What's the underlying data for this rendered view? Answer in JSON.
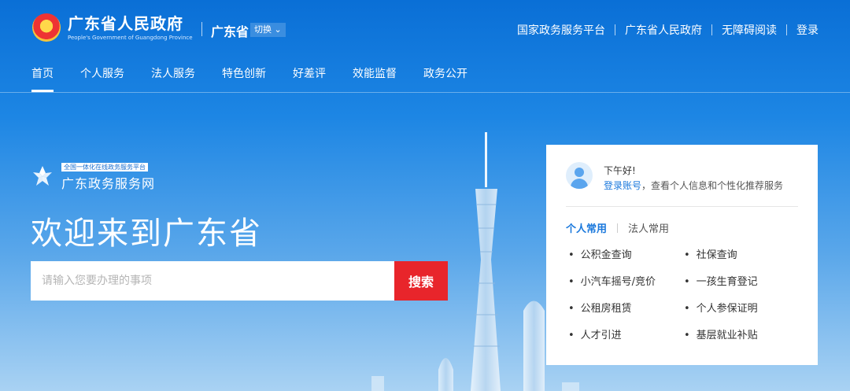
{
  "header": {
    "gov_title": "广东省人民政府",
    "gov_subtitle": "People's Government of Guangdong Province",
    "region": "广东省",
    "switch_label": "切换",
    "links": [
      "国家政务服务平台",
      "广东省人民政府",
      "无障碍阅读",
      "登录"
    ]
  },
  "nav": {
    "items": [
      "首页",
      "个人服务",
      "法人服务",
      "特色创新",
      "好差评",
      "效能监督",
      "政务公开"
    ],
    "active": "首页"
  },
  "hero": {
    "badge": "全国一体化在线政务服务平台",
    "brand_name": "广东政务服务网",
    "title": "欢迎来到广东省",
    "search_placeholder": "请输入您要办理的事项",
    "search_button": "搜索"
  },
  "panel": {
    "greeting": "下午好!",
    "login_link": "登录账号",
    "login_text": "，查看个人信息和个性化推荐服务",
    "tabs": [
      "个人常用",
      "法人常用"
    ],
    "active_tab": "个人常用",
    "services": [
      "公积金查询",
      "社保查询",
      "小汽车摇号/竞价",
      "一孩生育登记",
      "公租房租赁",
      "个人参保证明",
      "人才引进",
      "基层就业补贴"
    ]
  },
  "colors": {
    "primary_blue": "#1a78dc",
    "search_red": "#e8252b"
  }
}
